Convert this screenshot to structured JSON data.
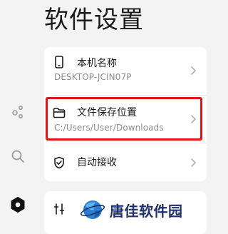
{
  "header": {
    "title": "软件设置"
  },
  "sidebar": {
    "items": [
      {
        "icon": "share-nodes-icon"
      },
      {
        "icon": "search-icon"
      },
      {
        "icon": "settings-gear-icon"
      }
    ]
  },
  "settings": {
    "device_name": {
      "label": "本机名称",
      "value": "DESKTOP-JCIN07P",
      "icon": "phone-icon"
    },
    "file_save_location": {
      "label": "文件保存位置",
      "value": "C:/Users/User/Downloads",
      "icon": "folder-icon"
    },
    "auto_receive": {
      "label": "自动接收",
      "icon": "shield-check-icon"
    }
  },
  "advanced": {
    "icon": "sliders-icon"
  },
  "watermark": {
    "text": "唐佳软件园",
    "icon": "globe-logo-icon"
  },
  "colors": {
    "background": "#f3f3f3",
    "card": "#ffffff",
    "highlight_border": "#e0141a",
    "watermark": "#1e2f6b"
  }
}
